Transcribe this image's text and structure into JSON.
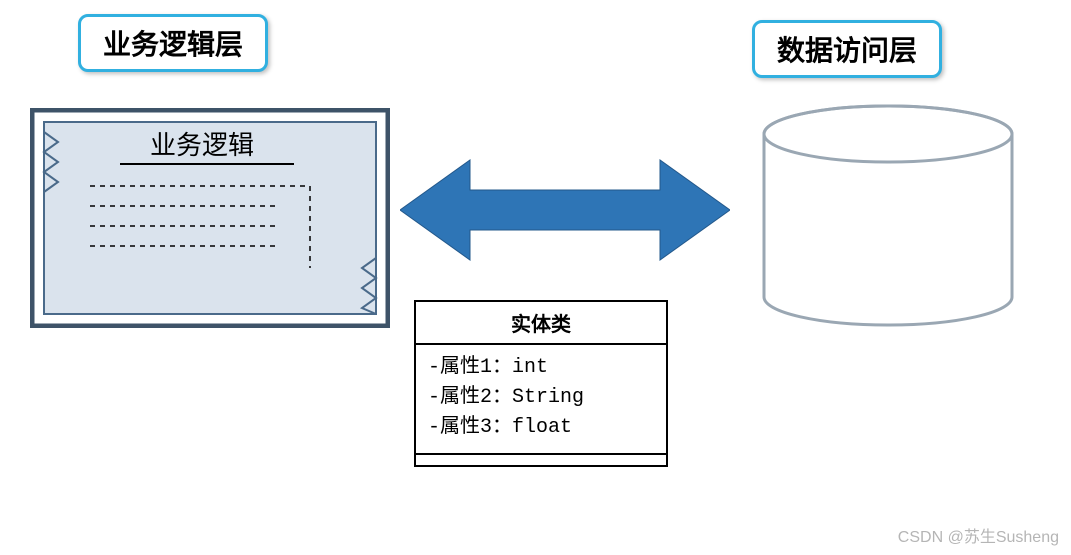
{
  "labels": {
    "business_layer": "业务逻辑层",
    "data_access_layer": "数据访问层"
  },
  "component": {
    "title": "业务逻辑"
  },
  "entity": {
    "title": "实体类",
    "attr1": "-属性1：int",
    "attr2": "-属性2：String",
    "attr3": "-属性3：float"
  },
  "watermark": "CSDN @苏生Susheng",
  "colors": {
    "label_border": "#31b0e0",
    "arrow": "#2e75b6",
    "component_fill": "#dae3ed",
    "component_stroke": "#4a6a8a"
  }
}
